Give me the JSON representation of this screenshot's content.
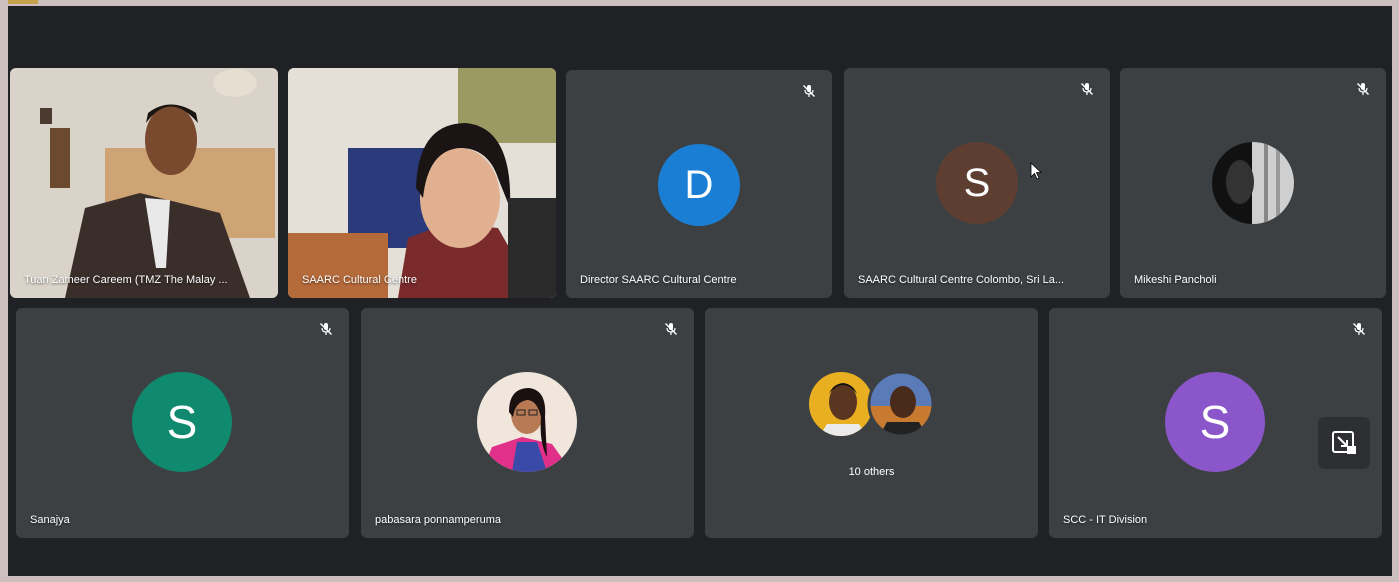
{
  "tiles": [
    {
      "name": "Tuan Zameer Careem (TMZ The Malay ..."
    },
    {
      "name": "SAARC Cultural Centre"
    },
    {
      "name": "Director SAARC Cultural Centre",
      "initial": "D",
      "color": "#1a7fd4"
    },
    {
      "name": "SAARC Cultural Centre Colombo, Sri La...",
      "initial": "S",
      "color": "#5d3e30"
    },
    {
      "name": "Mikeshi Pancholi"
    },
    {
      "name": "Sanajya",
      "initial": "S",
      "color": "#0f8a6e"
    },
    {
      "name": "pabasara ponnamperuma"
    },
    {
      "others_label": "10 others"
    },
    {
      "name": "SCC - IT Division",
      "initial": "S",
      "color": "#8a56c9"
    }
  ],
  "icons": {
    "mute": "mic-off-icon",
    "pip": "picture-in-picture-icon"
  }
}
